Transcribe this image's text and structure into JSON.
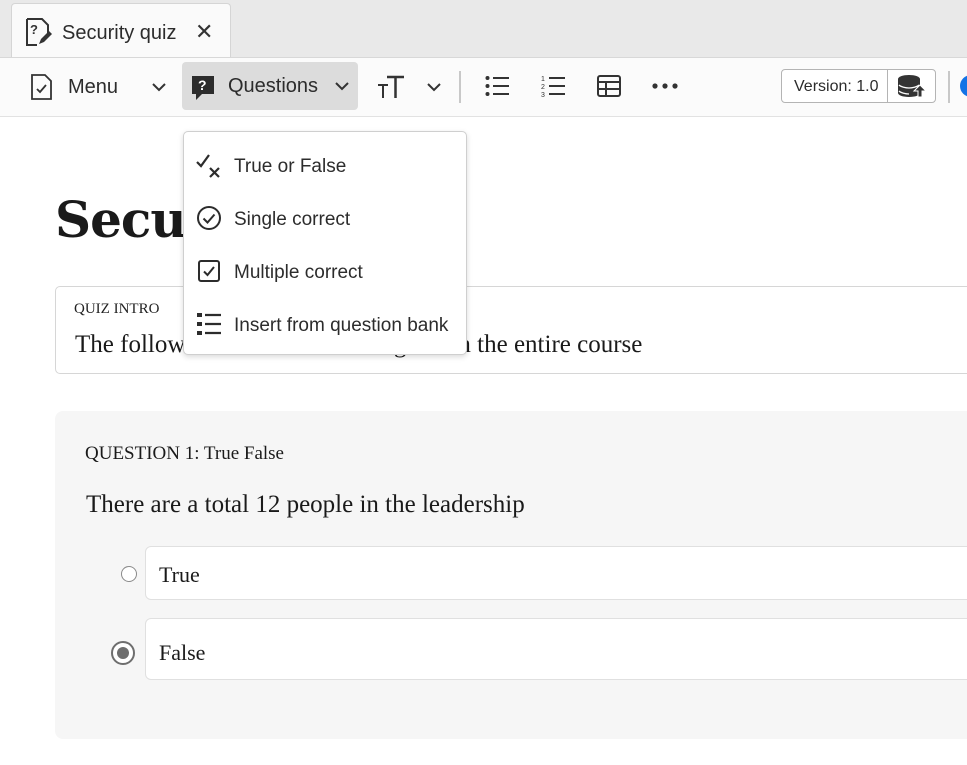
{
  "tab": {
    "title": "Security quiz",
    "close": "✕"
  },
  "toolbar": {
    "menu_label": "Menu",
    "questions_label": "Questions",
    "version_label": "Version: 1.0"
  },
  "dropdown": {
    "items": [
      {
        "label": "True or False"
      },
      {
        "label": "Single correct"
      },
      {
        "label": "Multiple correct"
      },
      {
        "label": "Insert from question bank"
      }
    ]
  },
  "page": {
    "title": "Secur",
    "intro_label": "QUIZ INTRO",
    "intro_text": "The follow",
    "intro_text_tail": "ings from the entire course"
  },
  "question": {
    "header": "QUESTION 1: True False",
    "text": "There are a total 12 people in the leadership",
    "options": [
      {
        "label": "True",
        "selected": false
      },
      {
        "label": "False",
        "selected": true
      }
    ]
  },
  "colors": {
    "accent": "#1473e6",
    "selected_button_bg": "#dcdcdc"
  }
}
